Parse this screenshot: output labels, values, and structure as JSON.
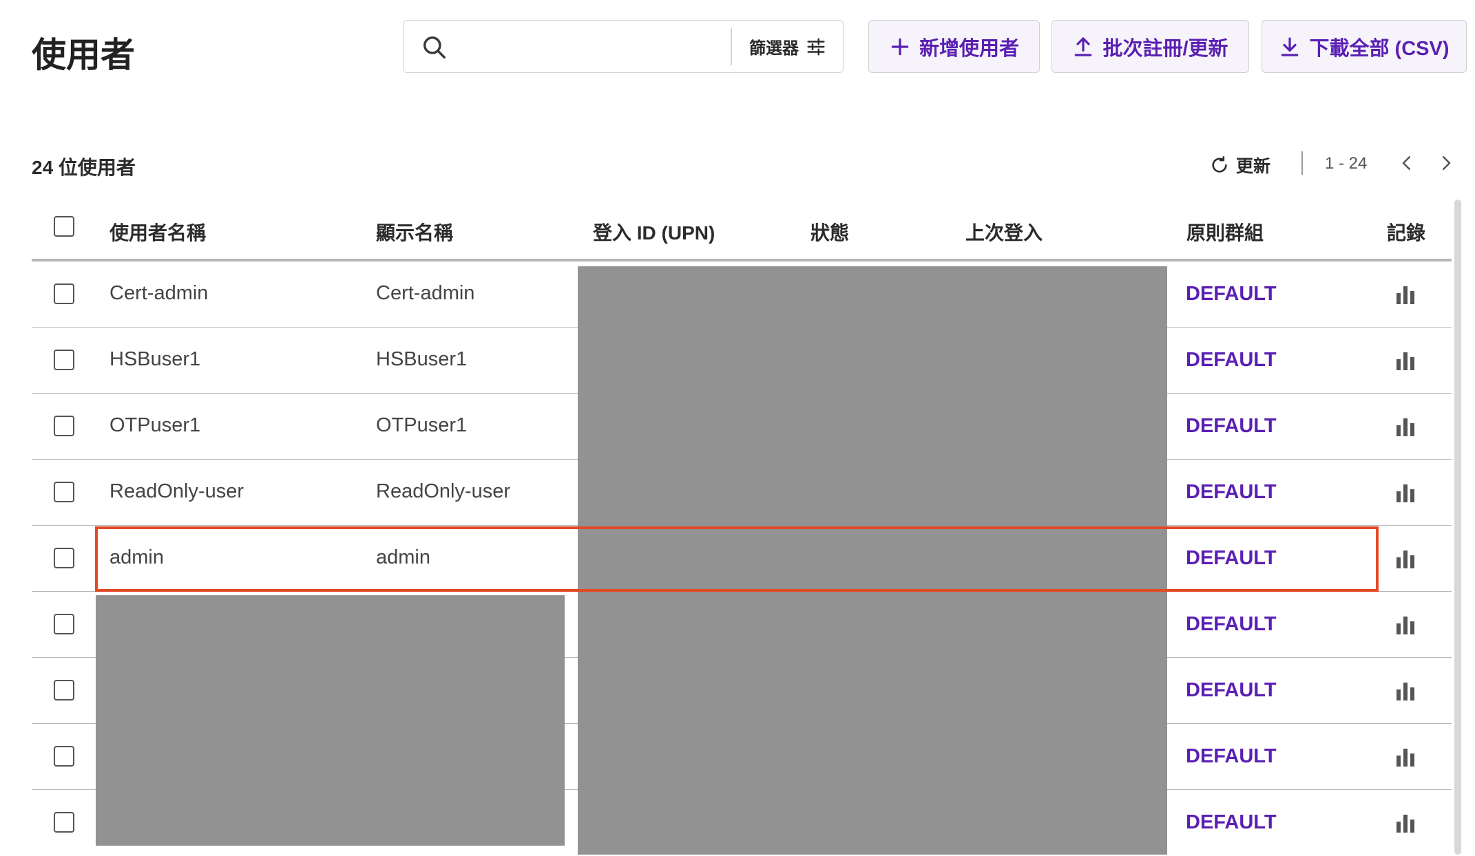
{
  "page": {
    "title": "使用者"
  },
  "search": {
    "placeholder": "",
    "value": "",
    "filter_label": "篩選器"
  },
  "actions": {
    "add_user": "新增使用者",
    "bulk_register": "批次註冊/更新",
    "download_all": "下載全部 (CSV)"
  },
  "list": {
    "count_label": "24 位使用者",
    "refresh_label": "更新",
    "range": "1 - 24"
  },
  "table": {
    "headers": {
      "username": "使用者名稱",
      "display_name": "顯示名稱",
      "login_id": "登入 ID (UPN)",
      "status": "狀態",
      "last_login": "上次登入",
      "policy_group": "原則群組",
      "records": "記錄"
    },
    "rows": [
      {
        "username": "Cert-admin",
        "display_name": "Cert-admin",
        "policy_group": "DEFAULT"
      },
      {
        "username": "HSBuser1",
        "display_name": "HSBuser1",
        "policy_group": "DEFAULT"
      },
      {
        "username": "OTPuser1",
        "display_name": "OTPuser1",
        "policy_group": "DEFAULT"
      },
      {
        "username": "ReadOnly-user",
        "display_name": "ReadOnly-user",
        "policy_group": "DEFAULT"
      },
      {
        "username": "admin",
        "display_name": "admin",
        "policy_group": "DEFAULT"
      },
      {
        "username": "",
        "display_name": "",
        "policy_group": "DEFAULT"
      },
      {
        "username": "",
        "display_name": "",
        "policy_group": "DEFAULT"
      },
      {
        "username": "",
        "display_name": "",
        "policy_group": "DEFAULT"
      },
      {
        "username": "",
        "display_name": "",
        "policy_group": "DEFAULT"
      }
    ]
  },
  "icons": {
    "search": "search-icon",
    "filter": "sliders-icon",
    "add": "plus-icon",
    "upload": "upload-icon",
    "download": "download-icon",
    "refresh": "refresh-icon",
    "prev": "chevron-left-icon",
    "next": "chevron-right-icon",
    "records": "bar-chart-icon"
  },
  "colors": {
    "accent": "#5a1fb3",
    "highlight": "#e24a26",
    "redaction": "#929292"
  }
}
